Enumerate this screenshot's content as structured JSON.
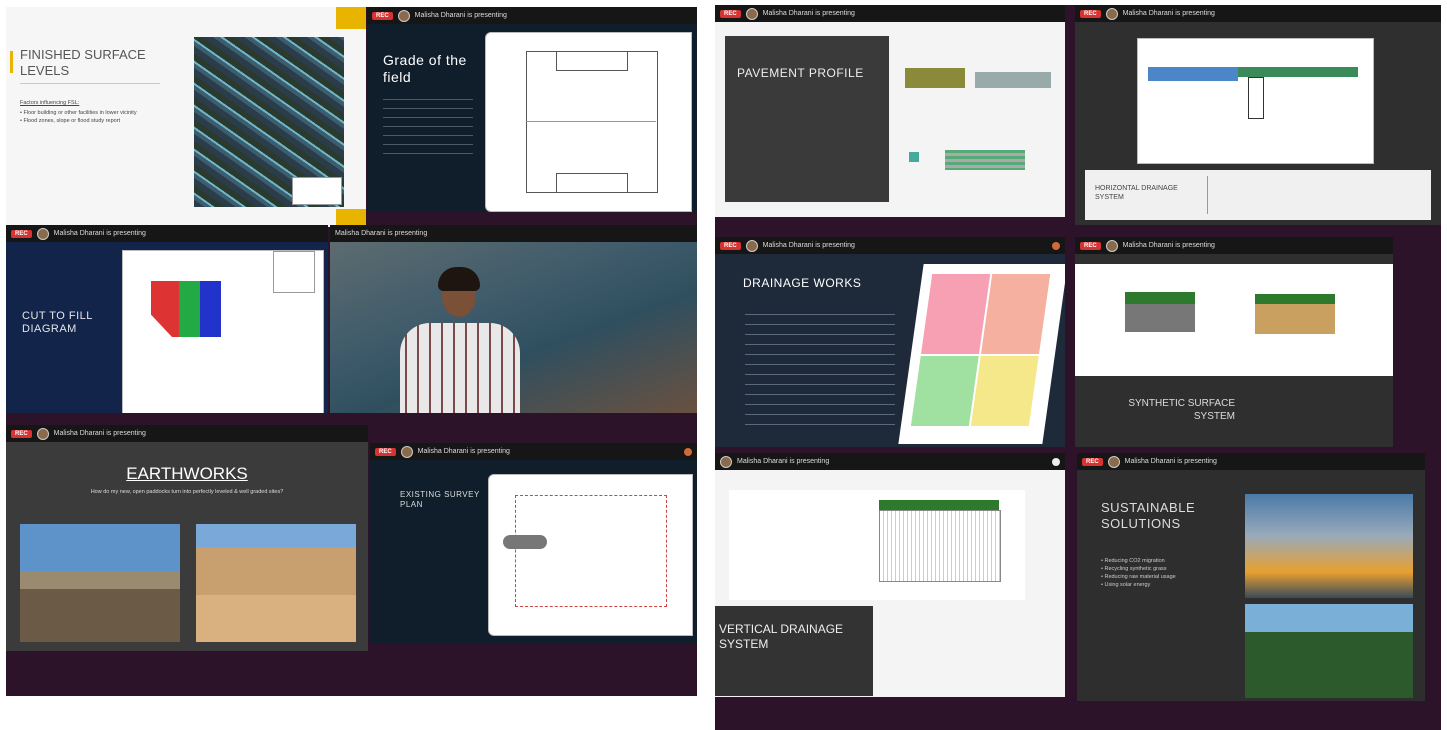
{
  "presenter_text": "Malisha Dharani is presenting",
  "rec_label": "REC",
  "slides": {
    "finished_surface": {
      "title": "FINISHED SURFACE LEVELS",
      "subtitle": "Factors influencing FSL:",
      "bullets": [
        "Floor building or other facilities in lower vicinity",
        "Flood zones, slope or flood study report"
      ]
    },
    "grade_field": {
      "title": "Grade of the field"
    },
    "cut_fill": {
      "title": "CUT TO FILL DIAGRAM"
    },
    "earthworks": {
      "title": "EARTHWORKS",
      "subtitle": "How do my new, open paddocks turn into perfectly leveled & well graded sites?"
    },
    "survey_plan": {
      "title": "EXISTING SURVEY PLAN"
    },
    "pavement": {
      "title": "PAVEMENT PROFILE"
    },
    "horizontal": {
      "title": "HORIZONTAL DRAINAGE SYSTEM"
    },
    "drainage_works": {
      "title": "DRAINAGE WORKS"
    },
    "synthetic": {
      "title": "SYNTHETIC SURFACE SYSTEM"
    },
    "vertical": {
      "title": "VERTICAL DRAINAGE SYSTEM"
    },
    "sustainable": {
      "title": "SUSTAINABLE SOLUTIONS",
      "bullets": [
        "Reducing CO2 migration",
        "Recycling synthetic grass",
        "Reducing raw material usage",
        "Using solar energy"
      ]
    }
  },
  "colors": {
    "panel": "#2c1329",
    "accent": "#e8b400"
  }
}
